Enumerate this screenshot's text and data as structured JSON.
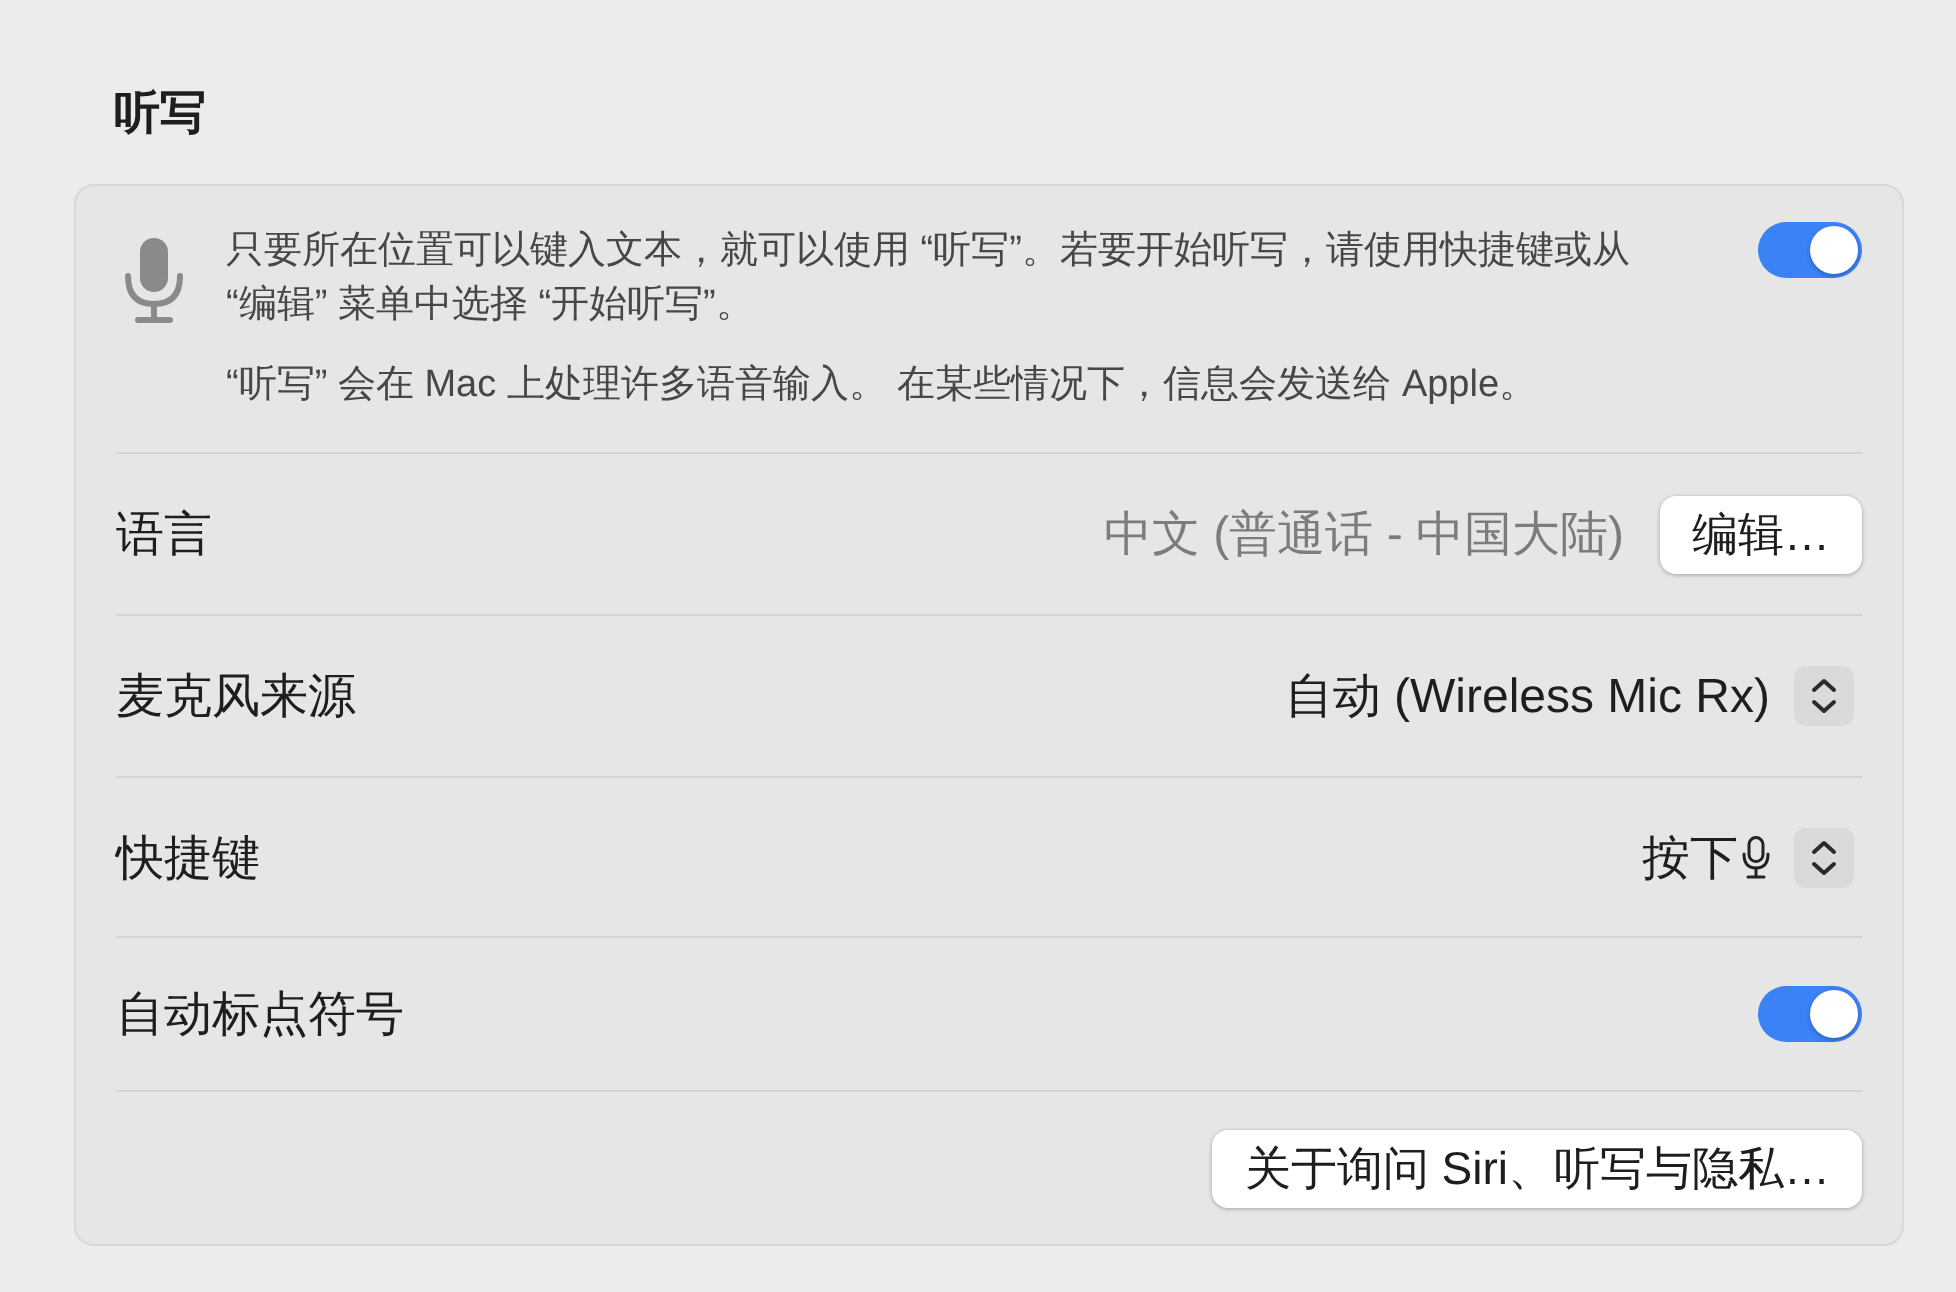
{
  "section_title": "听写",
  "dictation": {
    "description": "只要所在位置可以键入文本，就可以使用 “听写”。若要开始听写，请使用快捷键或从 “编辑” 菜单中选择 “开始听写”。",
    "note": "“听写” 会在 Mac 上处理许多语音输入。 在某些情况下，信息会发送给 Apple。",
    "on": true
  },
  "rows": [
    {
      "kind": "button",
      "label": "语言",
      "value": "中文 (普通话 - 中国大陆)",
      "button": "编辑…"
    },
    {
      "kind": "popup",
      "label": "麦克风来源",
      "value": "自动 (Wireless Mic Rx)"
    },
    {
      "kind": "shortcut",
      "label": "快捷键",
      "value": "按下"
    },
    {
      "kind": "toggle",
      "label": "自动标点符号",
      "on": true
    }
  ],
  "footer_button": "关于询问 Siri、听写与隐私…"
}
